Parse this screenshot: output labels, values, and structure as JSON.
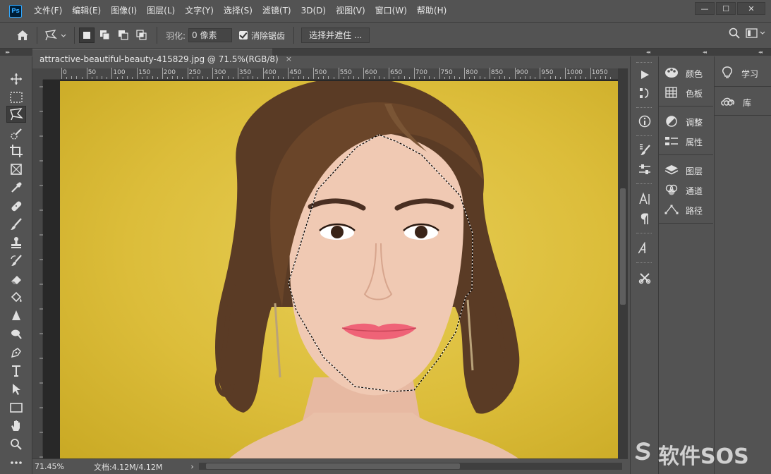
{
  "app": {
    "logo_text": "Ps",
    "window_buttons": [
      "—",
      "☐",
      "✕"
    ]
  },
  "menu": [
    "文件(F)",
    "编辑(E)",
    "图像(I)",
    "图层(L)",
    "文字(Y)",
    "选择(S)",
    "滤镜(T)",
    "3D(D)",
    "视图(V)",
    "窗口(W)",
    "帮助(H)"
  ],
  "options": {
    "feather_label": "羽化:",
    "feather_value": "0 像素",
    "antialias_label": "消除锯齿",
    "antialias_checked": true,
    "select_mask_button": "选择并遮住 ..."
  },
  "document": {
    "tab_title": "attractive-beautiful-beauty-415829.jpg @ 71.5%(RGB/8)",
    "tab_close": "×"
  },
  "ruler": {
    "h_labels": [
      "0",
      "50",
      "100",
      "150",
      "200",
      "250",
      "300",
      "350",
      "400",
      "450",
      "500",
      "550",
      "600",
      "650",
      "700",
      "750",
      "800",
      "850",
      "900",
      "950",
      "1000",
      "1050"
    ]
  },
  "status": {
    "zoom": "71.45%",
    "doc_size": "文档:4.12M/4.12M",
    "arrow": "›"
  },
  "tools": [
    "move",
    "rectangular-marquee",
    "polygonal-lasso",
    "quick-selection",
    "crop",
    "frame",
    "eyedropper",
    "healing-brush",
    "brush",
    "clone-stamp",
    "history-brush",
    "eraser",
    "paint-bucket",
    "blur",
    "dodge",
    "pen",
    "type",
    "path-selection",
    "rectangle",
    "hand",
    "zoom",
    "more"
  ],
  "panels": {
    "col1": [
      "颜色",
      "色板",
      "调整",
      "属性",
      "图层",
      "通道",
      "路径"
    ],
    "col2": [
      "学习",
      "库"
    ]
  },
  "watermark": {
    "text": "软件SOS"
  },
  "colors": {
    "ui_bg": "#535353",
    "canvas_bg": "#282828",
    "photo_bg": "#dcbd3a",
    "accent": "#31a8ff"
  }
}
